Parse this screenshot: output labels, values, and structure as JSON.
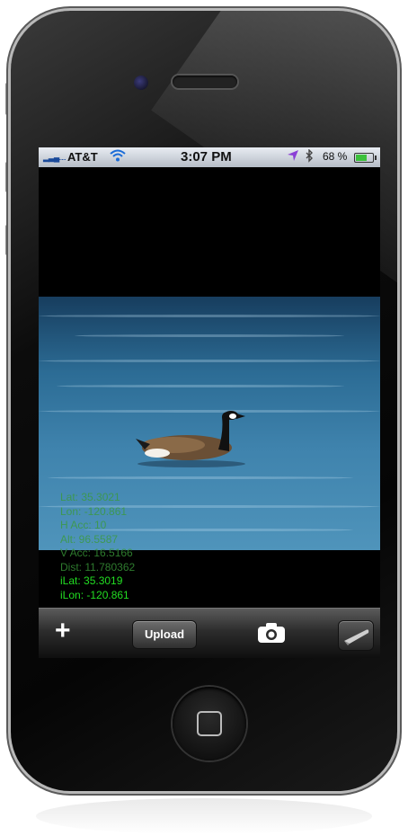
{
  "status_bar": {
    "carrier": "AT&T",
    "time": "3:07 PM",
    "battery_percent": "68 %",
    "battery_level": 0.68,
    "icons": [
      "signal-icon",
      "wifi-icon",
      "location-arrow-icon",
      "bluetooth-icon",
      "battery-icon"
    ]
  },
  "overlay": {
    "lines": [
      "Lat: 35.3021",
      "Lon: -120.861",
      "H Acc: 10",
      "Alt: 96.5587",
      "V Acc: 16.5166",
      "Dist: 11.780362",
      "iLat: 35.3019",
      "iLon: -120.861"
    ],
    "color": "#22dd22"
  },
  "toolbar": {
    "add_icon": "plus-icon",
    "upload_label": "Upload",
    "camera_icon": "camera-icon",
    "curl_icon": "page-curl-icon"
  },
  "colors": {
    "status_bar_bg": "#c9cfd8",
    "toolbar_bg": "#2c2c2c",
    "text_overlay": "#22dd22"
  }
}
